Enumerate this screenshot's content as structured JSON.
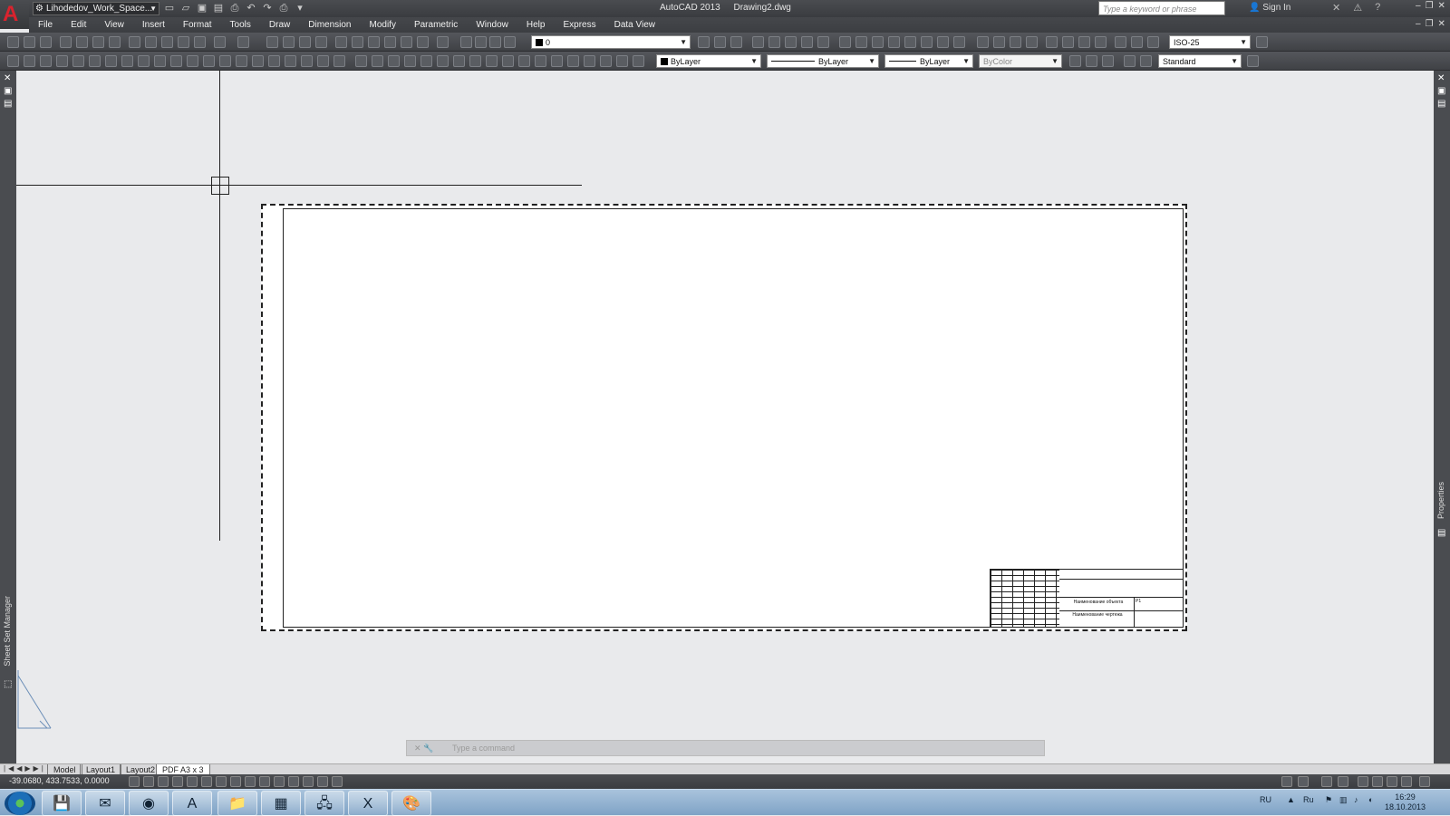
{
  "titlebar": {
    "workspace": "Lihodedov_Work_Space...",
    "app_title": "AutoCAD 2013",
    "file_name": "Drawing2.dwg",
    "search_placeholder": "Type a keyword or phrase",
    "sign_in": "Sign In"
  },
  "menu": [
    "File",
    "Edit",
    "View",
    "Insert",
    "Format",
    "Tools",
    "Draw",
    "Dimension",
    "Modify",
    "Parametric",
    "Window",
    "Help",
    "Express",
    "Data View"
  ],
  "toolbar": {
    "layer": "0",
    "dimstyle": "ISO-25",
    "color": "ByLayer",
    "linetype": "ByLayer",
    "lineweight": "ByLayer",
    "plotstyle": "ByColor",
    "tablestyle": "Standard"
  },
  "panels": {
    "sheet_set_manager": "Sheet Set Manager",
    "properties": "Properties"
  },
  "title_block": {
    "text1": "Наименование объекта",
    "text2": "Наименование чертежа",
    "text3": "P1"
  },
  "command_line": {
    "placeholder": "Type a command"
  },
  "tabs": [
    "Model",
    "Layout1",
    "Layout2",
    "PDF A3 x 3"
  ],
  "active_tab": "PDF A3 x 3",
  "status": {
    "coords": "-39.0680, 433.7533, 0.0000"
  },
  "taskbar": {
    "lang": "RU",
    "lang2": "Ru",
    "time": "16:29",
    "date": "18.10.2013"
  }
}
